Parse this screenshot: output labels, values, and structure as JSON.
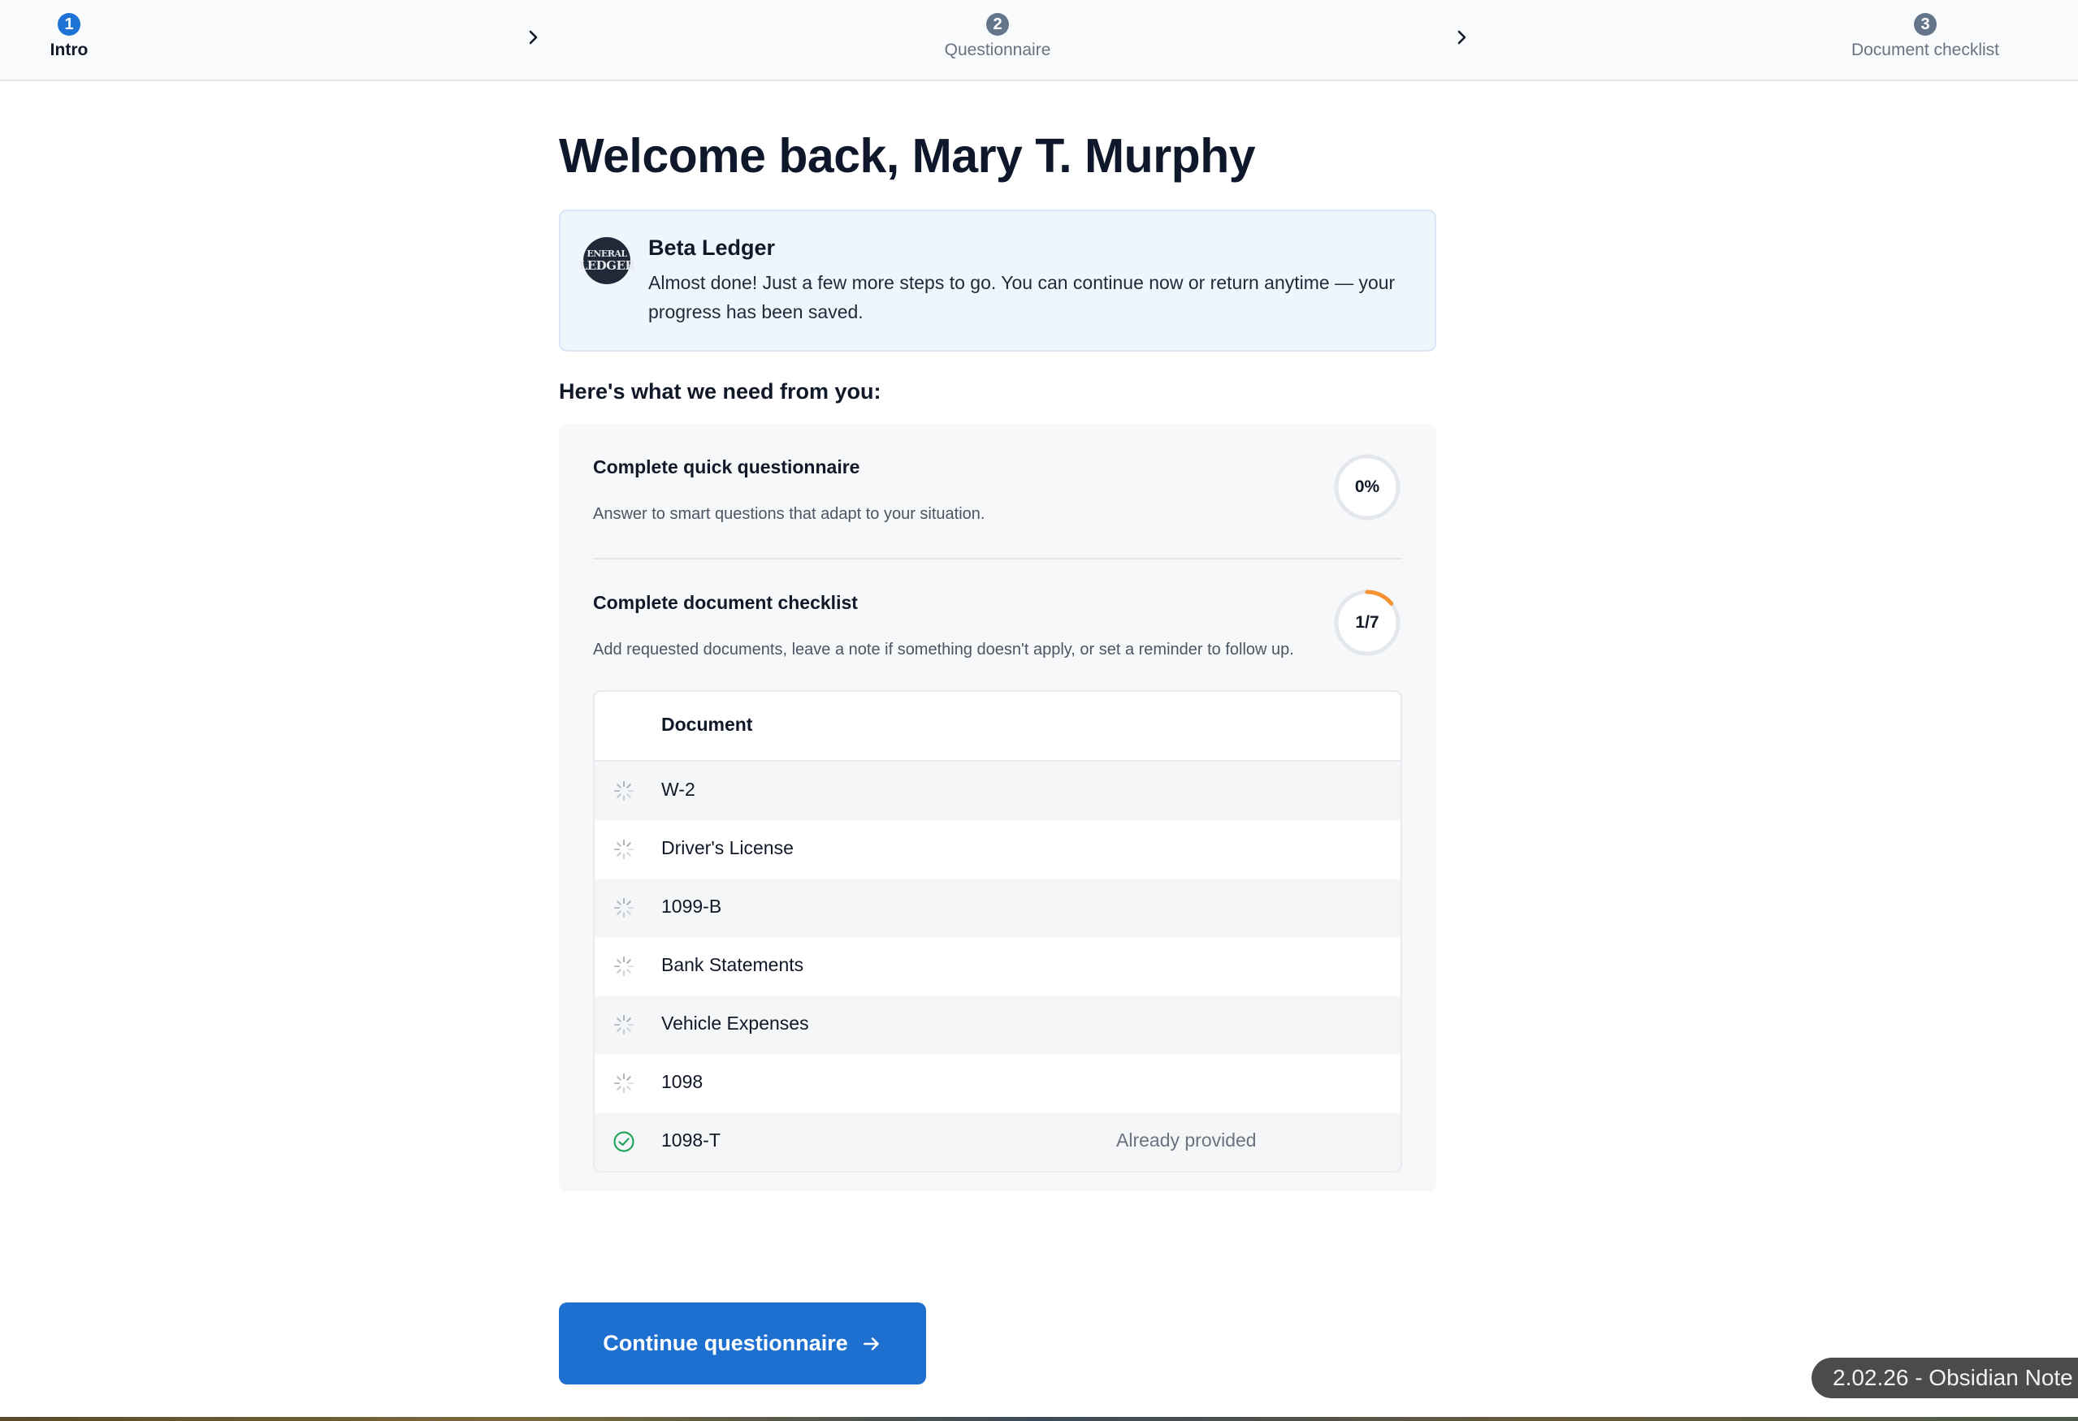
{
  "stepper": {
    "steps": [
      {
        "num": "1",
        "label": "Intro"
      },
      {
        "num": "2",
        "label": "Questionnaire"
      },
      {
        "num": "3",
        "label": "Document checklist"
      }
    ],
    "active_index": 0
  },
  "main": {
    "welcome": "Welcome back, Mary T. Murphy",
    "banner": {
      "logo_top": "ENERAL",
      "logo_middle": "LEDGER",
      "title": "Beta Ledger",
      "text": "Almost done! Just a few more steps to go. You can continue now or return anytime — your progress has been saved."
    },
    "need_title": "Here's what we need from you:",
    "tasks": [
      {
        "title": "Complete quick questionnaire",
        "description": "Answer to smart questions that adapt to your situation.",
        "progress_label": "0%",
        "progress_fraction": 0
      },
      {
        "title": "Complete document checklist",
        "description": "Add requested documents, leave a note if something doesn't apply, or set a reminder to follow up.",
        "progress_label": "1/7",
        "progress_fraction": 0.1429
      }
    ],
    "documents": {
      "header": "Document",
      "rows": [
        {
          "name": "W-2",
          "status": "",
          "icon": "pending-spinner-icon"
        },
        {
          "name": "Driver's License",
          "status": "",
          "icon": "pending-spinner-icon"
        },
        {
          "name": "1099-B",
          "status": "",
          "icon": "pending-spinner-icon"
        },
        {
          "name": "Bank Statements",
          "status": "",
          "icon": "pending-spinner-icon"
        },
        {
          "name": "Vehicle Expenses",
          "status": "",
          "icon": "pending-spinner-icon"
        },
        {
          "name": "1098",
          "status": "",
          "icon": "pending-spinner-icon"
        },
        {
          "name": "1098-T",
          "status": "Already provided",
          "icon": "check-circle-icon"
        }
      ]
    }
  },
  "cta": {
    "label": "Continue questionnaire",
    "icon": "arrow-right-icon"
  },
  "toast": {
    "text": "2.02.26 - Obsidian Note"
  },
  "colors": {
    "accent": "#1d72d6",
    "progress_arc": "#f59331",
    "success": "#22a55b",
    "banner_bg": "#eef5fd"
  }
}
